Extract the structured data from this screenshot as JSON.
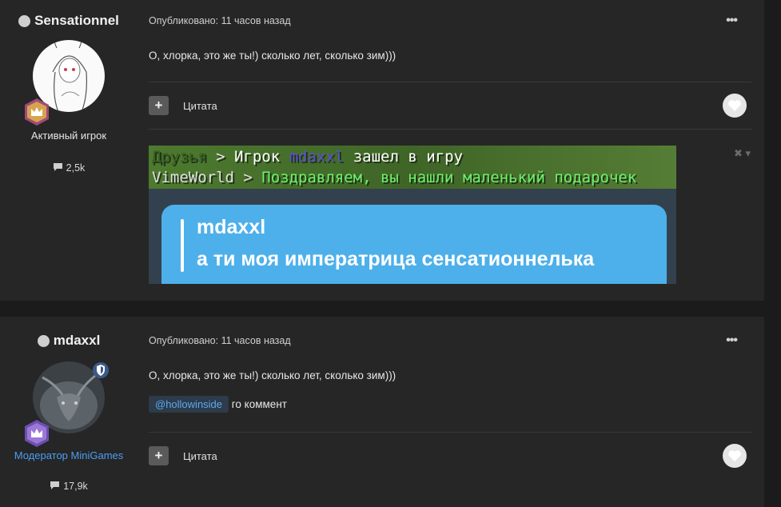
{
  "posts": [
    {
      "author": "Sensationnel",
      "role": "Активный игрок",
      "post_count": "2,5k",
      "published": "Опубликовано: 11 часов назад",
      "text": "О, хлорка, это же ты!) сколько лет, сколько зим)))",
      "quote_label": "Цитата",
      "embed": {
        "line1": {
          "prefix": "Друзья",
          "arrow": " > ",
          "middle": "Игрок ",
          "name": "mdaxxl",
          "suffix": " зашел в игру"
        },
        "line2": {
          "prefix": "VimeWorld",
          "arrow": " > ",
          "rest": "Поздравляем, вы нашли маленький подарочек"
        },
        "bubble_name": "mdaxxl",
        "bubble_text": "а ти моя императрица сенсатионнелька"
      }
    },
    {
      "author": "mdaxxl",
      "role": "Модератор MiniGames",
      "post_count": "17,9k",
      "published": "Опубликовано: 11 часов назад",
      "text": "О, хлорка, это же ты!) сколько лет, сколько зим)))",
      "mention": "@hollowinside",
      "mention_text": "го коммент",
      "quote_label": "Цитата"
    }
  ],
  "icons": {
    "menu": "ellipsis-icon",
    "quote": "plus-icon",
    "like": "heart-icon",
    "comment": "speech-bubble-icon",
    "rank": "crown-badge-icon",
    "moderator": "shield-icon"
  },
  "colors": {
    "role_moderator": "#4a9ff5",
    "mention": "#5aaaf0",
    "bubble": "#4db0ea"
  },
  "glyphs": {
    "menu": "•••",
    "plus": "+",
    "embed_close": "✖",
    "embed_caret": "▾"
  }
}
